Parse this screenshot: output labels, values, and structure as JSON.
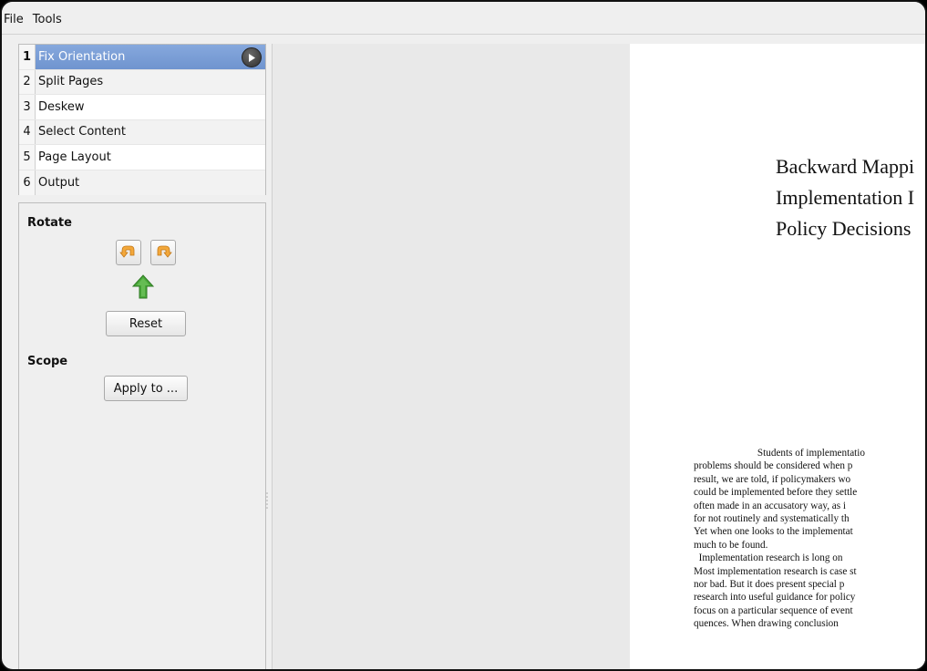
{
  "menubar": {
    "file": "File",
    "tools": "Tools"
  },
  "stages": [
    {
      "num": "1",
      "label": "Fix Orientation"
    },
    {
      "num": "2",
      "label": "Split Pages"
    },
    {
      "num": "3",
      "label": "Deskew"
    },
    {
      "num": "4",
      "label": "Select Content"
    },
    {
      "num": "5",
      "label": "Page Layout"
    },
    {
      "num": "6",
      "label": "Output"
    }
  ],
  "options": {
    "rotate_title": "Rotate",
    "reset_label": "Reset",
    "scope_title": "Scope",
    "apply_label": "Apply to ..."
  },
  "document": {
    "title_lines": [
      "Backward Mappi",
      "Implementation I",
      "Policy Decisions"
    ],
    "body_lines": [
      "                         Students of implementatio",
      "problems should be considered when p",
      "result, we are told, if policymakers wo",
      "could be implemented before they settle",
      "often made in an accusatory way, as i",
      "for not routinely and systematically th",
      "Yet when one looks to the implementat",
      "much to be found.",
      "  Implementation research is long on",
      "Most implementation research is case st",
      "nor bad. But it does present special p",
      "research into useful guidance for policy",
      "focus on a particular sequence of event",
      "quences. When drawing conclusion"
    ]
  },
  "colors": {
    "selection": "#7298d3",
    "arrow_orange": "#f0a437",
    "arrow_green": "#49a63a"
  },
  "icons": {
    "play": "play-circle-icon",
    "rotate_left": "rotate-left-icon",
    "rotate_right": "rotate-right-icon",
    "orientation": "up-arrow-icon"
  }
}
